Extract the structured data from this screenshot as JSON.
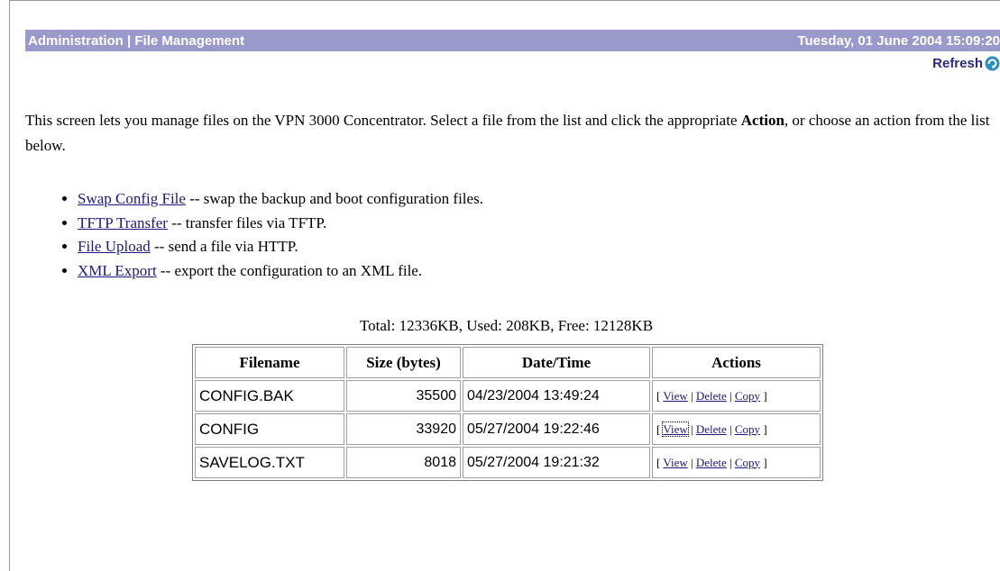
{
  "header": {
    "title": "Administration | File Management",
    "datetime": "Tuesday, 01 June 2004 15:09:20",
    "refresh_label": "Refresh",
    "refresh_icon": "refresh-icon"
  },
  "intro": {
    "text_before": "This screen lets you manage files on the VPN 3000 Concentrator. Select a file from the list and click the appropriate ",
    "bold_word": "Action",
    "text_after": ", or choose an action from the list below."
  },
  "actions": [
    {
      "link": "Swap Config File",
      "desc": " -- swap the backup and boot configuration files."
    },
    {
      "link": "TFTP Transfer",
      "desc": " -- transfer files via TFTP."
    },
    {
      "link": "File Upload",
      "desc": " -- send a file via HTTP."
    },
    {
      "link": "XML Export",
      "desc": " -- export the configuration to an XML file."
    }
  ],
  "totals": "Total: 12336KB, Used: 208KB, Free: 12128KB",
  "table": {
    "headers": [
      "Filename",
      "Size (bytes)",
      "Date/Time",
      "Actions"
    ],
    "rows": [
      {
        "filename": "CONFIG.BAK",
        "size": "35500",
        "datetime": "04/23/2004 13:49:24"
      },
      {
        "filename": "CONFIG",
        "size": "33920",
        "datetime": "05/27/2004 19:22:46"
      },
      {
        "filename": "SAVELOG.TXT",
        "size": "8018",
        "datetime": "05/27/2004 19:21:32"
      }
    ],
    "action_labels": {
      "open": "[ ",
      "view": "View",
      "sep": " | ",
      "delete": "Delete",
      "copy": "Copy",
      "close": " ]"
    }
  },
  "colors": {
    "titlebar": "#9999cc",
    "link": "#1a1a80"
  }
}
